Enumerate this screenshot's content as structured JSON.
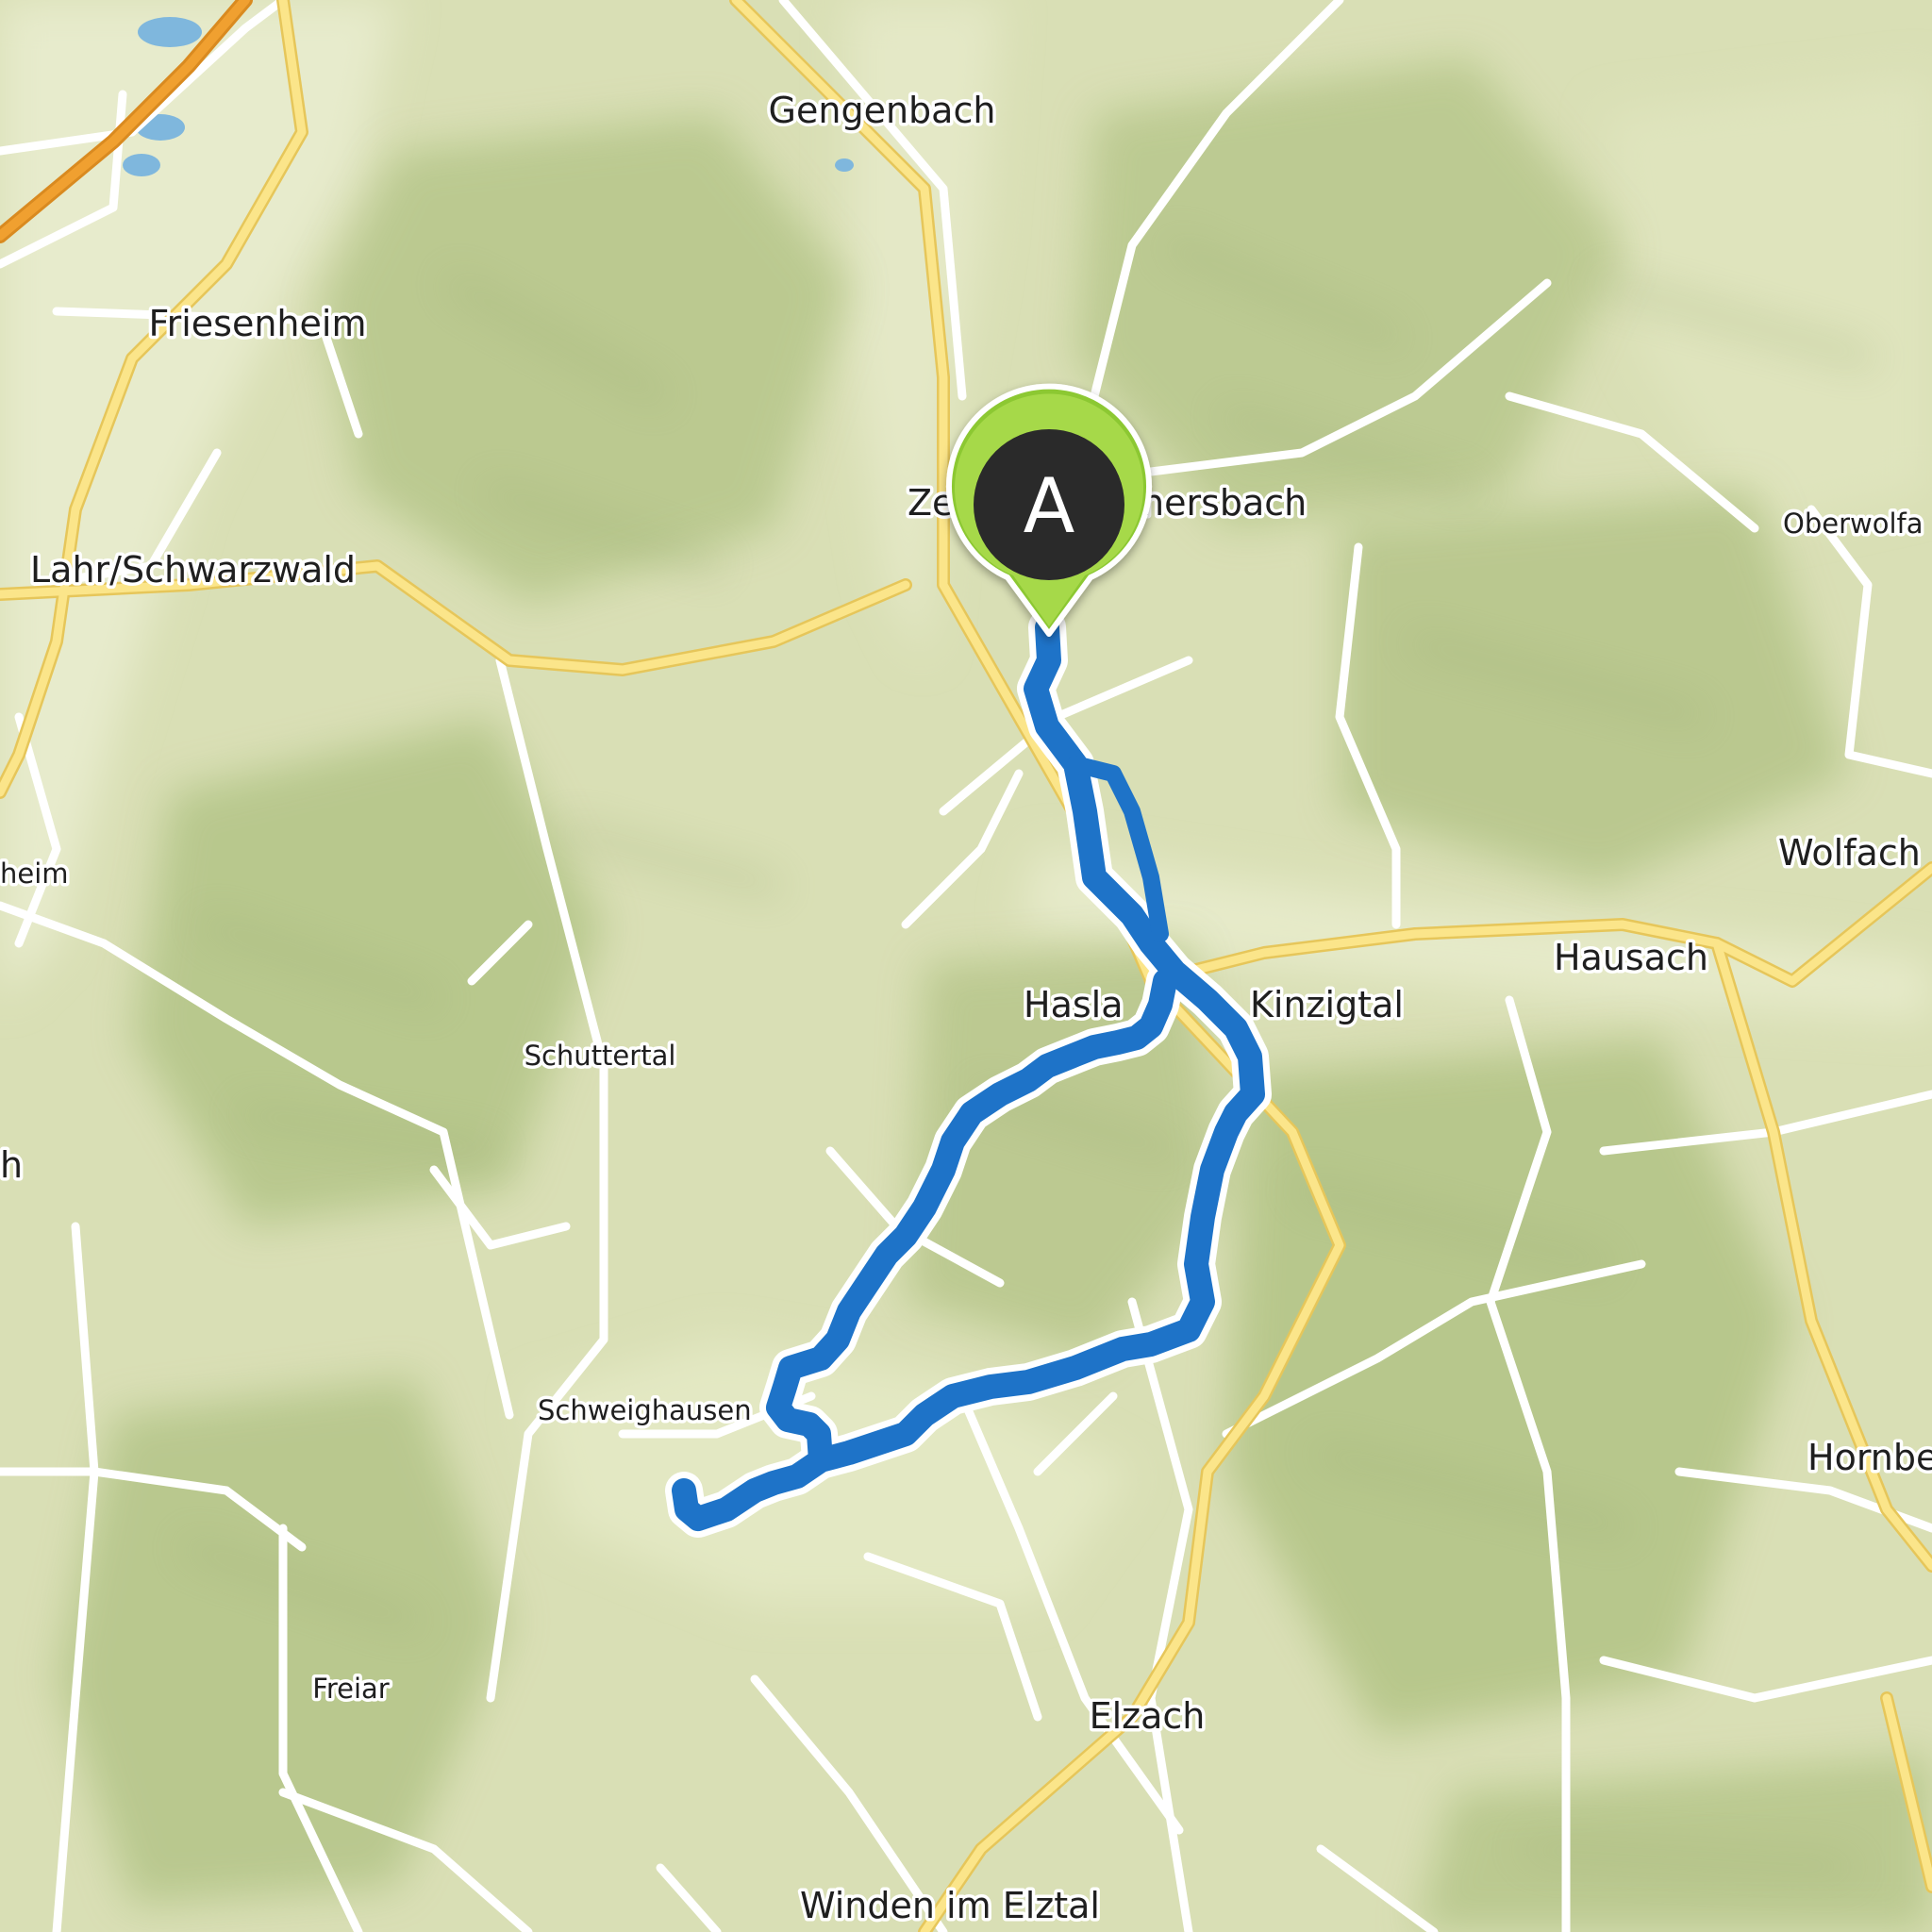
{
  "map": {
    "style": "topographic-terrain",
    "colors": {
      "terrain_base": "#d9dfb5",
      "terrain_light": "#e9ecd0",
      "forest": "#b9c98e",
      "ridge_shadow": "#9aab72",
      "minor_road": "#ffffff",
      "main_road": "#fbe58a",
      "main_road_casing": "#e6c65a",
      "motorway": "#f0a030",
      "water": "#7fb7dd",
      "route": "#1e73c8",
      "route_casing": "#ffffff",
      "marker_fill": "#2a2a2a",
      "marker_ring": "#8cc832"
    },
    "route": {
      "icon": "route-line"
    },
    "start_marker": {
      "label": "A",
      "icon": "map-pin-icon"
    },
    "labels": {
      "gengenbach": "Gengenbach",
      "friesenheim": "Friesenheim",
      "lahr": "Lahr/Schwarzwald",
      "zell_left": "Ze",
      "zell_right": "nersbach",
      "oberwolfach": "Oberwolfa",
      "heim": "heim",
      "wolfach": "Wolfach",
      "hausach": "Hausach",
      "haslach": "Hasla",
      "kinzigtal": "Kinzigtal",
      "schuttertal": "Schuttertal",
      "h": "h",
      "schweighausen": "Schweighausen",
      "hornberg": "Hornbe",
      "freiamt": "Freiar",
      "elzach": "Elzach",
      "winden": "Winden im Elztal"
    }
  }
}
